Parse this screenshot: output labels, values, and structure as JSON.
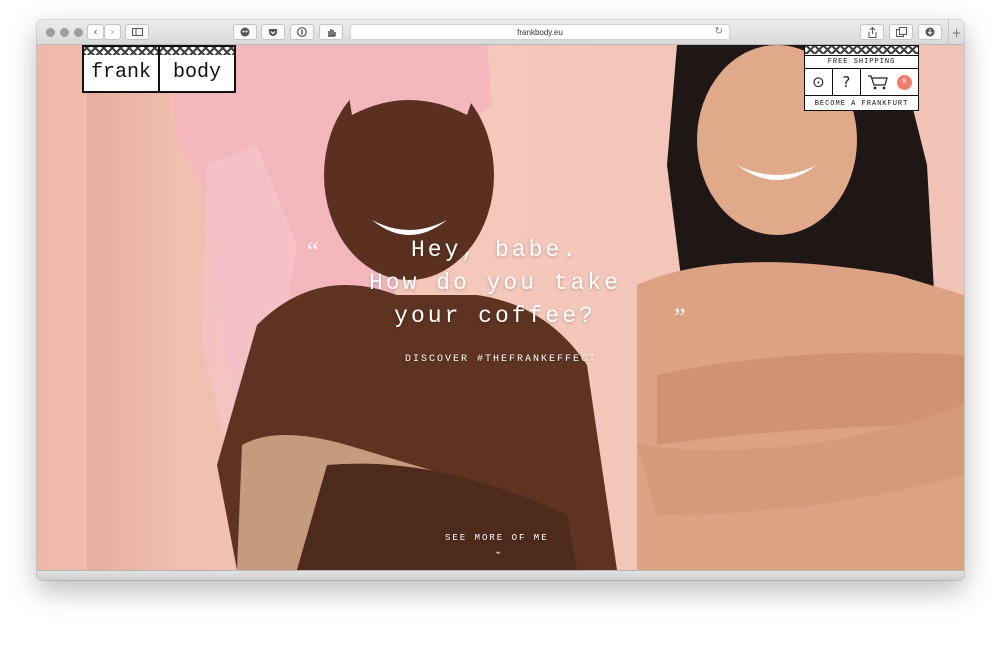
{
  "browser": {
    "url": "frankbody.eu",
    "back_icon": "‹",
    "forward_icon": "›",
    "reload_icon": "↻",
    "new_tab_icon": "+",
    "toolbar_icons": [
      "sidebar-icon",
      "ghostery-icon",
      "pocket-icon",
      "1password-icon",
      "hand-icon",
      "share-icon",
      "tabs-icon",
      "download-icon"
    ]
  },
  "site": {
    "logo": {
      "left": "frank",
      "right": "body"
    },
    "nav": {
      "shipping": "FREE SHIPPING",
      "location_icon": "⊙",
      "help_icon": "?",
      "cart_icon": "🛒",
      "cart_count": "0",
      "frankfurt": "BECOME A FRANKFURT"
    },
    "hero": {
      "open_quote": "“",
      "close_quote": "”",
      "line1": "Hey, babe.",
      "line2": "How do you take",
      "line3": "your coffee?",
      "discover": "DISCOVER #THEFRANKEFFECT",
      "see_more": "SEE MORE OF ME",
      "chevron": "⌄"
    }
  },
  "colors": {
    "background_pink": "#f3c9bb",
    "towel_pink": "#f3b7bd",
    "badge": "#f07f6f"
  }
}
